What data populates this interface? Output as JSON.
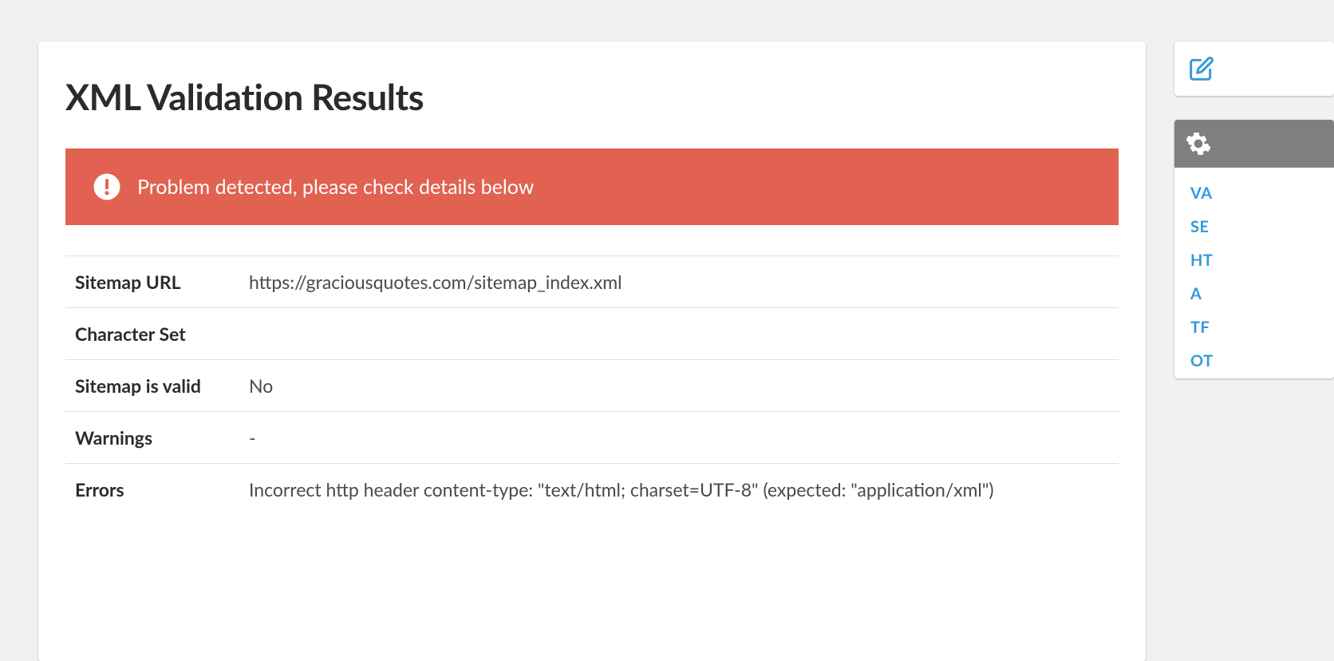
{
  "header": {
    "title": "XML Validation Results"
  },
  "alert": {
    "message": "Problem detected, please check details below"
  },
  "results": {
    "rows": [
      {
        "label": "Sitemap URL",
        "value": "https://graciousquotes.com/sitemap_index.xml"
      },
      {
        "label": "Character Set",
        "value": ""
      },
      {
        "label": "Sitemap is valid",
        "value": "No"
      },
      {
        "label": "Warnings",
        "value": "-"
      },
      {
        "label": "Errors",
        "value": "Incorrect http header content-type: \"text/html; charset=UTF-8\" (expected: \"application/xml\")"
      }
    ]
  },
  "sidebar": {
    "nav": [
      "VA",
      "SE",
      "HT",
      "A",
      "TF",
      "OT"
    ]
  }
}
